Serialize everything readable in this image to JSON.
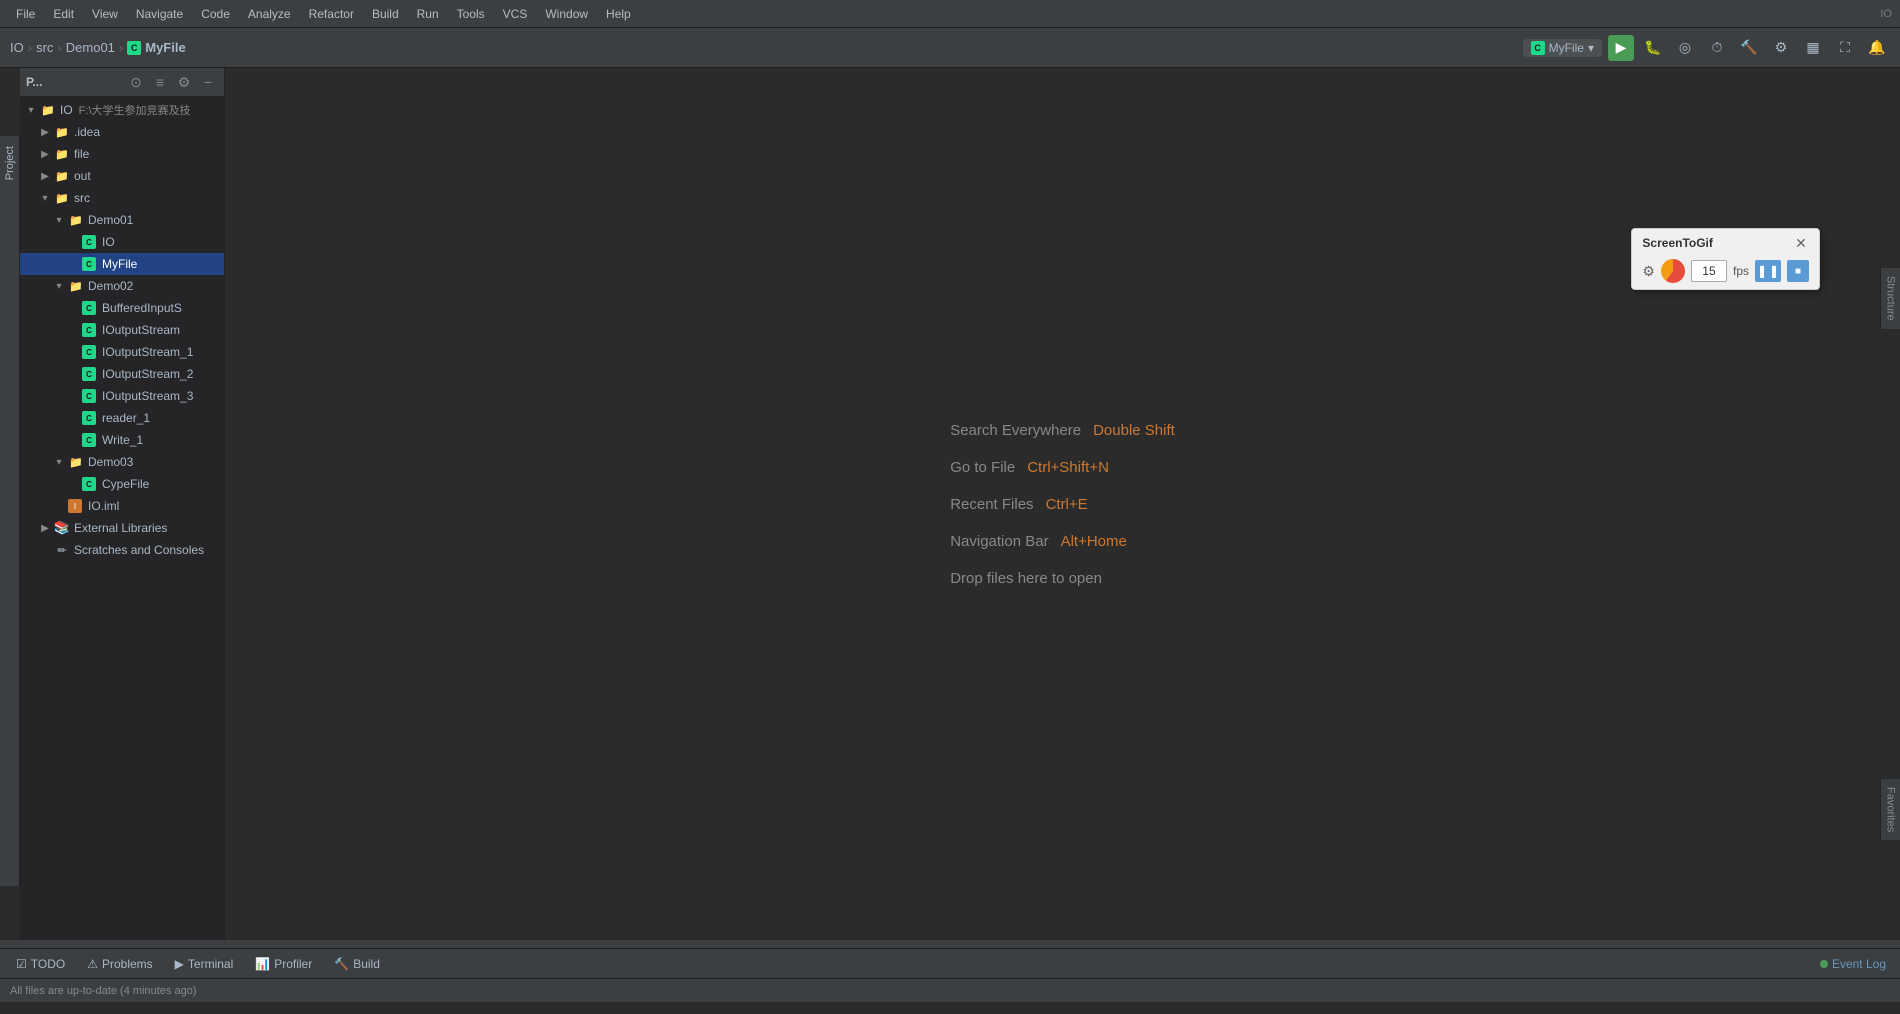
{
  "menubar": {
    "items": [
      "File",
      "Edit",
      "View",
      "Navigate",
      "Code",
      "Analyze",
      "Refactor",
      "Build",
      "Run",
      "Tools",
      "VCS",
      "Window",
      "Help"
    ],
    "io_label": "IO"
  },
  "toolbar": {
    "breadcrumb": {
      "items": [
        "IO",
        "src",
        "Demo01"
      ],
      "active": "MyFile"
    },
    "run_config": "MyFile",
    "buttons": {
      "run": "▶",
      "debug": "🐛",
      "coverage": "◎",
      "profile": "⏱"
    }
  },
  "project_panel": {
    "label": "P...",
    "root": {
      "name": "IO",
      "path": "F:\\大学生参加竞赛及技"
    },
    "tree": [
      {
        "indent": 1,
        "type": "folder",
        "name": ".idea",
        "expanded": false
      },
      {
        "indent": 1,
        "type": "folder",
        "name": "file",
        "expanded": false
      },
      {
        "indent": 1,
        "type": "folder-brown",
        "name": "out",
        "expanded": false
      },
      {
        "indent": 1,
        "type": "folder-src",
        "name": "src",
        "expanded": true
      },
      {
        "indent": 2,
        "type": "folder",
        "name": "Demo01",
        "expanded": true
      },
      {
        "indent": 3,
        "type": "class",
        "name": "IO"
      },
      {
        "indent": 3,
        "type": "class",
        "name": "MyFile",
        "selected": true
      },
      {
        "indent": 2,
        "type": "folder",
        "name": "Demo02",
        "expanded": true
      },
      {
        "indent": 3,
        "type": "class",
        "name": "BufferedInputS"
      },
      {
        "indent": 3,
        "type": "class",
        "name": "IOutputStream"
      },
      {
        "indent": 3,
        "type": "class",
        "name": "IOutputStream_1"
      },
      {
        "indent": 3,
        "type": "class",
        "name": "IOutputStream_2"
      },
      {
        "indent": 3,
        "type": "class",
        "name": "IOutputStream_3"
      },
      {
        "indent": 3,
        "type": "class",
        "name": "reader_1"
      },
      {
        "indent": 3,
        "type": "class",
        "name": "Write_1"
      },
      {
        "indent": 2,
        "type": "folder",
        "name": "Demo03",
        "expanded": true
      },
      {
        "indent": 3,
        "type": "class",
        "name": "CypeFile"
      },
      {
        "indent": 2,
        "type": "iml",
        "name": "IO.iml"
      },
      {
        "indent": 1,
        "type": "extlib",
        "name": "External Libraries",
        "expanded": false
      },
      {
        "indent": 1,
        "type": "scratch",
        "name": "Scratches and Consoles"
      }
    ]
  },
  "editor": {
    "hints": [
      {
        "label": "Search Everywhere",
        "shortcut": "Double Shift"
      },
      {
        "label": "Go to File",
        "shortcut": "Ctrl+Shift+N"
      },
      {
        "label": "Recent Files",
        "shortcut": "Ctrl+E"
      },
      {
        "label": "Navigation Bar",
        "shortcut": "Alt+Home"
      },
      {
        "label": "Drop files here to open",
        "shortcut": ""
      }
    ]
  },
  "screentogif": {
    "title": "ScreenToGif",
    "fps_value": "15",
    "fps_label": "fps"
  },
  "bottom_tabs": [
    {
      "icon": "☑",
      "label": "TODO"
    },
    {
      "icon": "⚠",
      "label": "Problems"
    },
    {
      "icon": "▶",
      "label": "Terminal"
    },
    {
      "icon": "📊",
      "label": "Profiler"
    },
    {
      "icon": "🔨",
      "label": "Build"
    }
  ],
  "status_bar": {
    "message": "All files are up-to-date (4 minutes ago)"
  },
  "event_log": "Event Log",
  "structure_label": "Structure",
  "favorites_label": "Favorites",
  "project_tab_label": "Project"
}
